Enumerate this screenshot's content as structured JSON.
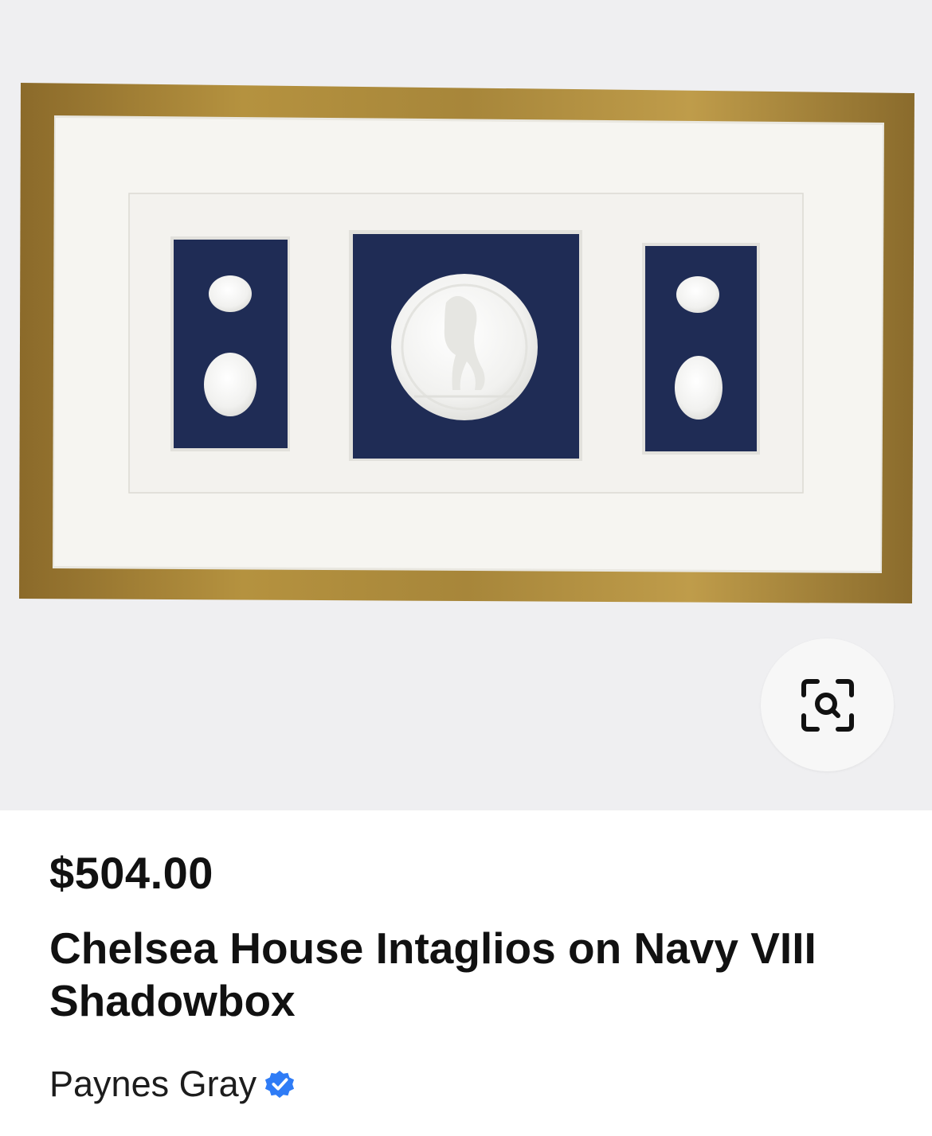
{
  "product": {
    "image_alt": "Framed white intaglios on navy shadowbox with gold frame",
    "price": "$504.00",
    "title": "Chelsea House Intaglios on Navy VIII Shadowbox",
    "seller": "Paynes Gray",
    "seller_verified": true
  },
  "icons": {
    "visual_search": "visual-search-icon",
    "verified": "verified-badge-icon"
  },
  "colors": {
    "image_background": "#efeff1",
    "frame_gold": "#a9863e",
    "mat": "#f6f5f1",
    "navy": "#1f2c55",
    "verified_blue": "#2f7cf6"
  }
}
